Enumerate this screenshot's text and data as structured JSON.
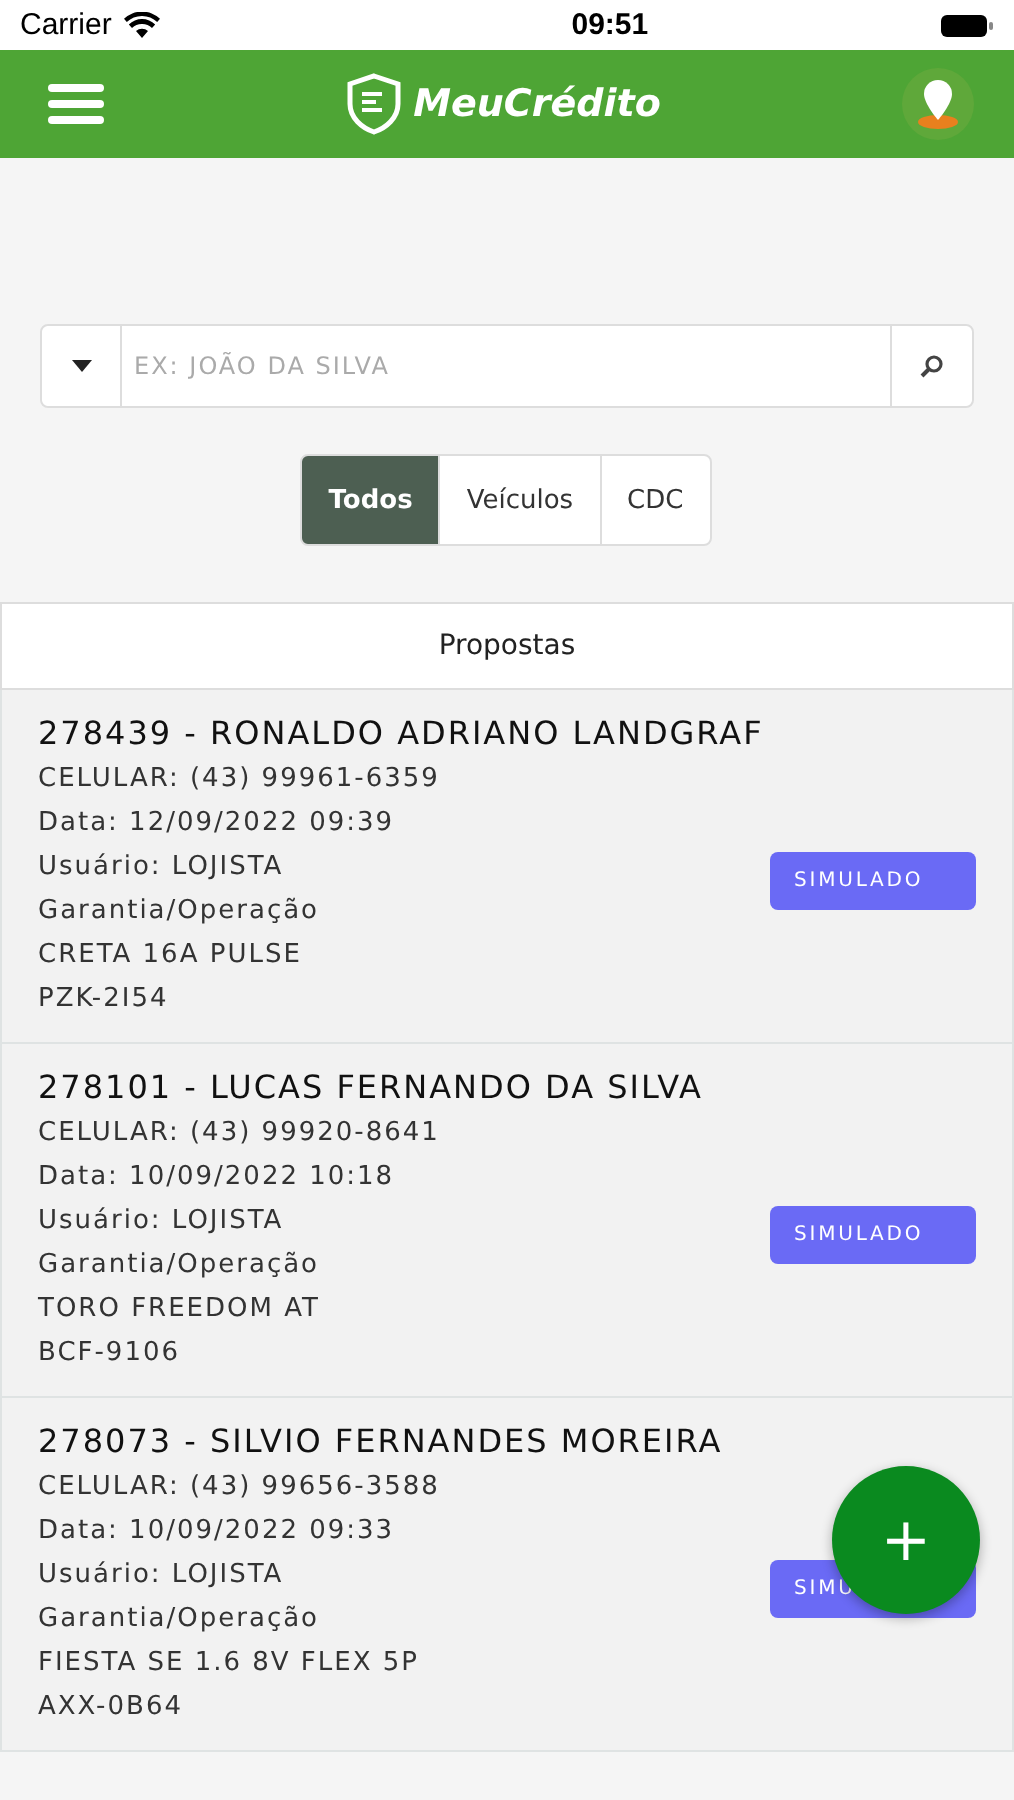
{
  "status_bar": {
    "carrier": "Carrier",
    "time": "09:51"
  },
  "header": {
    "logo_text": "MeuCrédito"
  },
  "search": {
    "placeholder": "EX: JOÃO DA SILVA"
  },
  "filters": [
    {
      "label": "Todos",
      "selected": true
    },
    {
      "label": "Veículos",
      "selected": false
    },
    {
      "label": "CDC",
      "selected": false
    }
  ],
  "list_title": "Propostas",
  "proposals": [
    {
      "title": "278439 - RONALDO ADRIANO LANDGRAF",
      "phone": "CELULAR: (43) 99961-6359",
      "date": "Data: 12/09/2022 09:39",
      "user": "Usuário: LOJISTA",
      "operation": "Garantia/Operação",
      "vehicle": "CRETA 16A PULSE",
      "plate": "PZK-2I54",
      "status": "SIMULADO"
    },
    {
      "title": "278101 - LUCAS FERNANDO DA SILVA",
      "phone": "CELULAR: (43) 99920-8641",
      "date": "Data: 10/09/2022 10:18",
      "user": "Usuário: LOJISTA",
      "operation": "Garantia/Operação",
      "vehicle": "TORO FREEDOM AT",
      "plate": "BCF-9106",
      "status": "SIMULADO"
    },
    {
      "title": "278073 - SILVIO FERNANDES MOREIRA",
      "phone": "CELULAR: (43) 99656-3588",
      "date": "Data: 10/09/2022 09:33",
      "user": "Usuário: LOJISTA",
      "operation": "Garantia/Operação",
      "vehicle": "FIESTA SE 1.6 8V FLEX 5P",
      "plate": "AXX-0B64",
      "status": "SIMU"
    }
  ],
  "fab": {
    "label": "+"
  }
}
